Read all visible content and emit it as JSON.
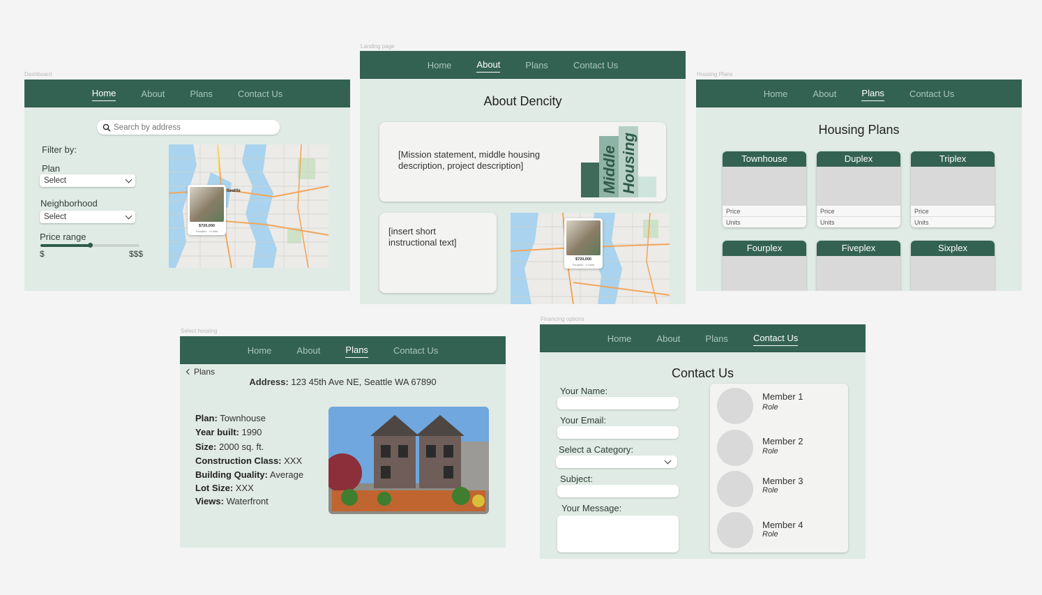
{
  "frames": {
    "dashboard": "Dashboard",
    "landing": "Landing page",
    "housing_plans": "Housing Plans",
    "select_housing": "Select housing",
    "financing": "Financing options"
  },
  "nav": {
    "home": "Home",
    "about": "About",
    "plans": "Plans",
    "contact": "Contact Us"
  },
  "dashboard": {
    "search_placeholder": "Search by address",
    "filter_by": "Filter by:",
    "plan_label": "Plan",
    "plan_value": "Select",
    "neighborhood_label": "Neighborhood",
    "neighborhood_value": "Select",
    "price_label": "Price range",
    "price_min": "$",
    "price_max": "$$$",
    "price_fill": 0.5
  },
  "map": {
    "city": "Seattle",
    "price": "$720,000",
    "sub": "Fourplex · 4 Units"
  },
  "about": {
    "title": "About Dencity",
    "mission": "[Mission statement, middle housing description, project description]",
    "word1": "Middle",
    "word2": "Housing",
    "instructional": "[insert short instructional text]"
  },
  "plans": {
    "title": "Housing Plans",
    "price_label": "Price",
    "units_label": "Units",
    "items": [
      "Townhouse",
      "Duplex",
      "Triplex",
      "Fourplex",
      "Fiveplex",
      "Sixplex"
    ]
  },
  "select_housing": {
    "back": "Plans",
    "address_label": "Address:",
    "address": "123 45th Ave NE, Seattle WA 67890",
    "details": [
      {
        "k": "Plan:",
        "v": "Townhouse"
      },
      {
        "k": "Year built:",
        "v": "1990"
      },
      {
        "k": "Size:",
        "v": "2000 sq. ft."
      },
      {
        "k": "Construction Class:",
        "v": "XXX"
      },
      {
        "k": "Building Quality:",
        "v": "Average"
      },
      {
        "k": "Lot Size:",
        "v": "XXX"
      },
      {
        "k": "Views:",
        "v": "Waterfront"
      }
    ]
  },
  "contact": {
    "title": "Contact Us",
    "name_label": "Your Name:",
    "email_label": "Your Email:",
    "category_label": "Select a Category:",
    "subject_label": "Subject:",
    "message_label": "Your Message:",
    "members": [
      {
        "name": "Member 1",
        "role": "Role"
      },
      {
        "name": "Member 2",
        "role": "Role"
      },
      {
        "name": "Member 3",
        "role": "Role"
      },
      {
        "name": "Member 4",
        "role": "Role"
      }
    ]
  },
  "colors": {
    "nav": "#336252",
    "bg": "#e0ebe5",
    "accent": "#2f5a4a"
  }
}
